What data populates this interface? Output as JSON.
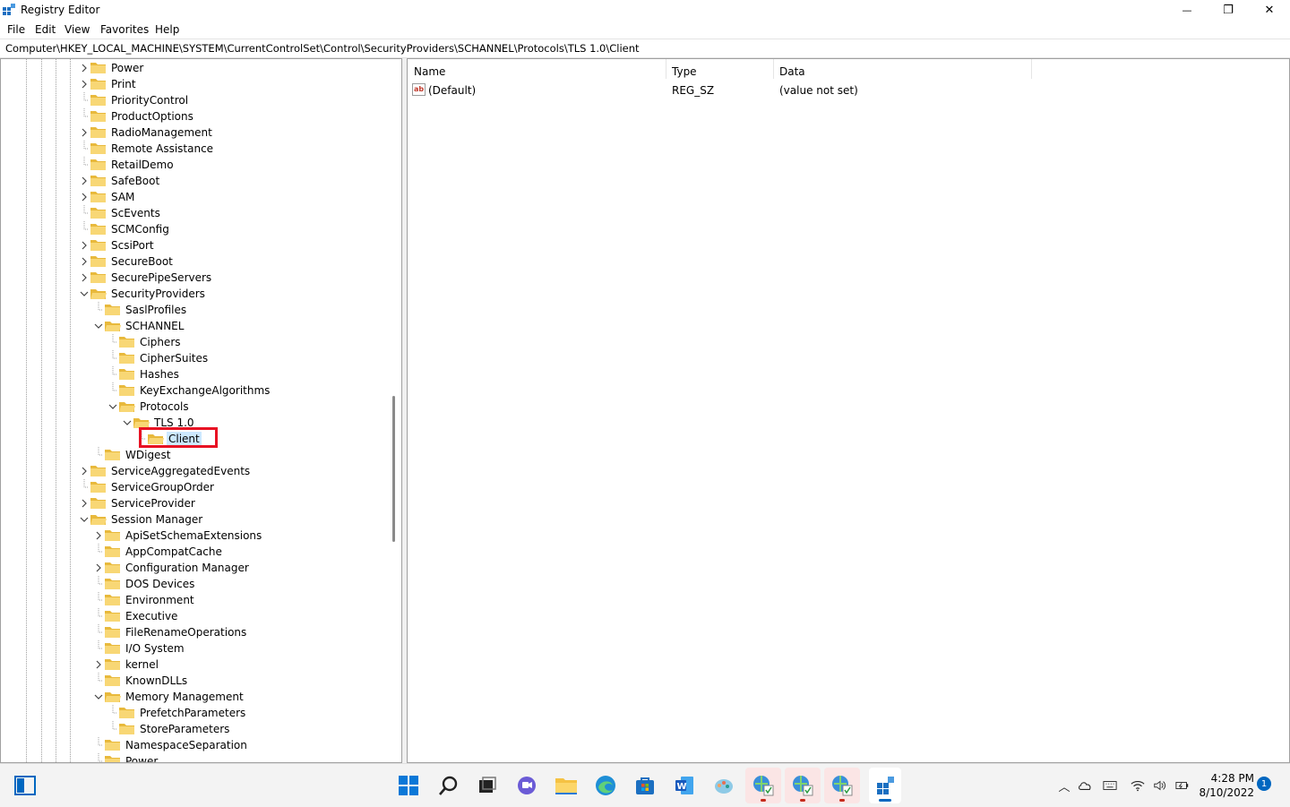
{
  "window": {
    "title": "Registry Editor",
    "minimize_glyph": "—",
    "maximize_glyph": "❐",
    "close_glyph": "✕"
  },
  "menu": [
    "File",
    "Edit",
    "View",
    "Favorites",
    "Help"
  ],
  "address": "Computer\\HKEY_LOCAL_MACHINE\\SYSTEM\\CurrentControlSet\\Control\\SecurityProviders\\SCHANNEL\\Protocols\\TLS 1.0\\Client",
  "tree": [
    {
      "label": "Power",
      "level": 0,
      "expander": "collapsed"
    },
    {
      "label": "Print",
      "level": 0,
      "expander": "collapsed"
    },
    {
      "label": "PriorityControl",
      "level": 0,
      "expander": "none"
    },
    {
      "label": "ProductOptions",
      "level": 0,
      "expander": "none"
    },
    {
      "label": "RadioManagement",
      "level": 0,
      "expander": "collapsed"
    },
    {
      "label": "Remote Assistance",
      "level": 0,
      "expander": "none"
    },
    {
      "label": "RetailDemo",
      "level": 0,
      "expander": "none"
    },
    {
      "label": "SafeBoot",
      "level": 0,
      "expander": "collapsed"
    },
    {
      "label": "SAM",
      "level": 0,
      "expander": "collapsed"
    },
    {
      "label": "ScEvents",
      "level": 0,
      "expander": "none"
    },
    {
      "label": "SCMConfig",
      "level": 0,
      "expander": "none"
    },
    {
      "label": "ScsiPort",
      "level": 0,
      "expander": "collapsed"
    },
    {
      "label": "SecureBoot",
      "level": 0,
      "expander": "collapsed"
    },
    {
      "label": "SecurePipeServers",
      "level": 0,
      "expander": "collapsed"
    },
    {
      "label": "SecurityProviders",
      "level": 0,
      "expander": "expanded"
    },
    {
      "label": "SaslProfiles",
      "level": 1,
      "expander": "none"
    },
    {
      "label": "SCHANNEL",
      "level": 1,
      "expander": "expanded"
    },
    {
      "label": "Ciphers",
      "level": 2,
      "expander": "none"
    },
    {
      "label": "CipherSuites",
      "level": 2,
      "expander": "none"
    },
    {
      "label": "Hashes",
      "level": 2,
      "expander": "none"
    },
    {
      "label": "KeyExchangeAlgorithms",
      "level": 2,
      "expander": "none"
    },
    {
      "label": "Protocols",
      "level": 2,
      "expander": "expanded"
    },
    {
      "label": "TLS 1.0",
      "level": 3,
      "expander": "expanded"
    },
    {
      "label": "Client",
      "level": 4,
      "expander": "none",
      "selected": true
    },
    {
      "label": "WDigest",
      "level": 1,
      "expander": "none"
    },
    {
      "label": "ServiceAggregatedEvents",
      "level": 0,
      "expander": "collapsed"
    },
    {
      "label": "ServiceGroupOrder",
      "level": 0,
      "expander": "none"
    },
    {
      "label": "ServiceProvider",
      "level": 0,
      "expander": "collapsed"
    },
    {
      "label": "Session Manager",
      "level": 0,
      "expander": "expanded"
    },
    {
      "label": "ApiSetSchemaExtensions",
      "level": 1,
      "expander": "collapsed"
    },
    {
      "label": "AppCompatCache",
      "level": 1,
      "expander": "none"
    },
    {
      "label": "Configuration Manager",
      "level": 1,
      "expander": "collapsed"
    },
    {
      "label": "DOS Devices",
      "level": 1,
      "expander": "none"
    },
    {
      "label": "Environment",
      "level": 1,
      "expander": "none"
    },
    {
      "label": "Executive",
      "level": 1,
      "expander": "none"
    },
    {
      "label": "FileRenameOperations",
      "level": 1,
      "expander": "none"
    },
    {
      "label": "I/O System",
      "level": 1,
      "expander": "none"
    },
    {
      "label": "kernel",
      "level": 1,
      "expander": "collapsed"
    },
    {
      "label": "KnownDLLs",
      "level": 1,
      "expander": "none"
    },
    {
      "label": "Memory Management",
      "level": 1,
      "expander": "expanded"
    },
    {
      "label": "PrefetchParameters",
      "level": 2,
      "expander": "none"
    },
    {
      "label": "StoreParameters",
      "level": 2,
      "expander": "none"
    },
    {
      "label": "NamespaceSeparation",
      "level": 1,
      "expander": "none"
    },
    {
      "label": "Power",
      "level": 1,
      "expander": "none"
    }
  ],
  "values_pane": {
    "columns": [
      "Name",
      "Type",
      "Data"
    ],
    "rows": [
      {
        "name": "(Default)",
        "type": "REG_SZ",
        "data": "(value not set)",
        "icon": "string-value-icon"
      }
    ]
  },
  "taskbar": {
    "apps": [
      {
        "name": "start-menu-icon"
      },
      {
        "name": "search-icon"
      },
      {
        "name": "task-view-icon"
      },
      {
        "name": "chat-icon"
      },
      {
        "name": "file-explorer-icon"
      },
      {
        "name": "edge-icon"
      },
      {
        "name": "microsoft-store-icon"
      },
      {
        "name": "word-icon"
      },
      {
        "name": "paint-icon"
      },
      {
        "name": "network-tool-icon-1",
        "running": true
      },
      {
        "name": "network-tool-icon-2",
        "running": true
      },
      {
        "name": "network-tool-icon-3",
        "running": true
      },
      {
        "name": "registry-editor-icon",
        "running": true
      }
    ],
    "tray": [
      "chevron-up-icon",
      "onedrive-icon",
      "keyboard-icon",
      "wifi-icon",
      "volume-icon",
      "battery-icon"
    ],
    "time": "4:28 PM",
    "date": "8/10/2022",
    "notification_count": "1"
  },
  "colors": {
    "selection": "#cce8ff",
    "highlight_box": "#e81123",
    "folder": "#f8d775",
    "accent": "#0067c0"
  }
}
